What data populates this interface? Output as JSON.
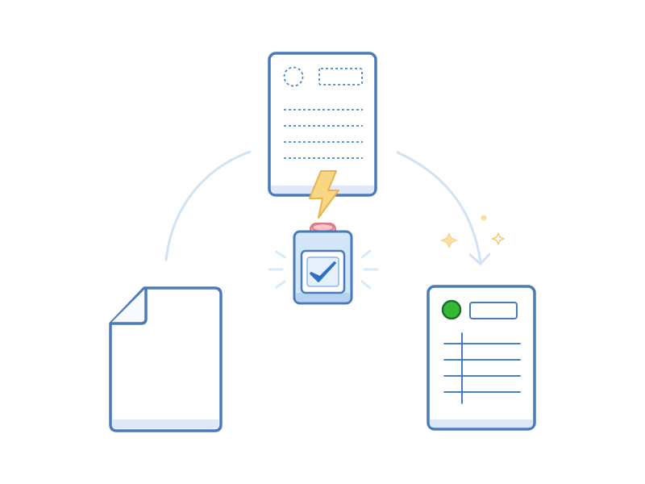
{
  "illustration": {
    "icons": [
      "blank-document-icon",
      "template-form-icon",
      "lightning-bolt-icon",
      "stamp-device-icon",
      "checkmark-icon",
      "filled-form-icon",
      "sparkle-icon"
    ]
  },
  "colors": {
    "outline": "#4a7ab8",
    "paper": "#ffffff",
    "paper_shadow": "#dfe8f6",
    "dotted_line": "#4a86c8",
    "arrow": "#cfe3f5",
    "lightning": "#f7d684",
    "lightning_stroke": "#e8b44d",
    "stamp_body": "#d2e6f8",
    "stamp_cap": "#f4a9ae",
    "check": "#2f70c4",
    "green_dot": "#33b933",
    "blue_line": "#2f72bd",
    "sparkle": "#f7dfa6"
  }
}
